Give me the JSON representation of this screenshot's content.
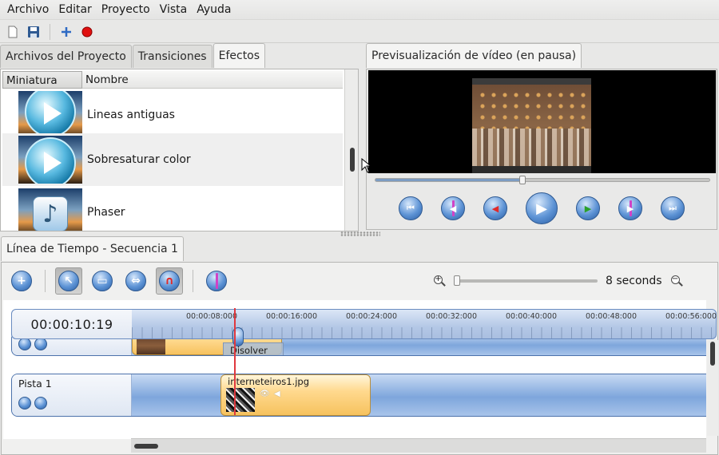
{
  "menu": [
    "Archivo",
    "Editar",
    "Proyecto",
    "Vista",
    "Ayuda"
  ],
  "toolbar": {
    "icons": [
      "new-file-icon",
      "save-icon",
      "add-icon",
      "record-icon"
    ]
  },
  "left_tabs": [
    "Archivos del Proyecto",
    "Transiciones",
    "Efectos"
  ],
  "effects_table": {
    "columns": [
      "Miniatura",
      "Nombre"
    ],
    "rows": [
      {
        "name": "Lineas antiguas",
        "icon": "play-orb-icon"
      },
      {
        "name": "Sobresaturar color",
        "icon": "play-orb-icon"
      },
      {
        "name": "Phaser",
        "icon": "music-note-icon"
      }
    ]
  },
  "preview": {
    "tab_label": "Previsualización de vídeo (en pausa)",
    "position_fraction": 0.44,
    "controls": [
      "jump-start-icon",
      "prev-marker-icon",
      "rewind-icon",
      "play-icon",
      "fast-forward-icon",
      "next-marker-icon",
      "jump-end-icon"
    ]
  },
  "timeline": {
    "tab_label": "Línea de Tiempo - Secuencia 1",
    "tools": [
      "add-track-icon",
      "select-tool-icon",
      "razor-tool-icon",
      "arrow-tool-icon",
      "snap-magnet-icon",
      "marker-icon"
    ],
    "zoom_label": "8 seconds",
    "timecode": "00:00:10:19",
    "ruler_labels": [
      "00:00:08:000",
      "00:00:16:000",
      "00:00:24:000",
      "00:00:32:000",
      "00:00:40:000",
      "00:00:48:000",
      "00:00:56:000"
    ],
    "tracks": [
      {
        "name": ""
      },
      {
        "name": "Pista 1"
      }
    ],
    "transition_label": "Disolver",
    "clip_label": "interneteiros1.jpg"
  },
  "colors": {
    "accent_blue": "#5d93d5",
    "clip_orange": "#ffd98e",
    "playhead_red": "#e0383e",
    "marker_magenta": "#d043c6"
  }
}
